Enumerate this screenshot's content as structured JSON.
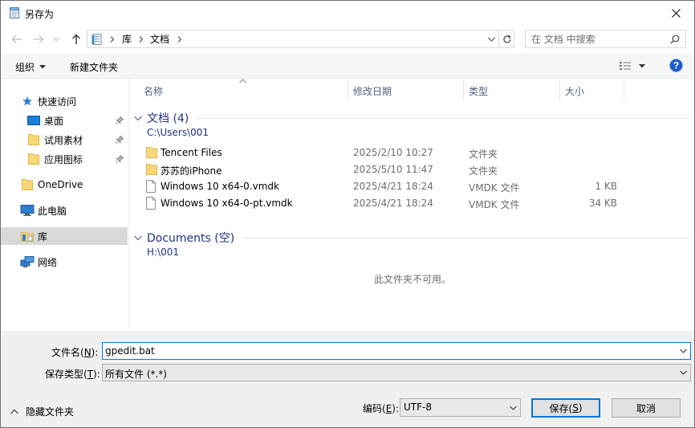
{
  "window": {
    "title": "另存为"
  },
  "address": {
    "crumbs": [
      "库",
      "文档"
    ]
  },
  "search": {
    "placeholder": "在 文档 中搜索"
  },
  "toolbar": {
    "organize_label": "组织",
    "new_folder_label": "新建文件夹"
  },
  "sidebar": {
    "items": [
      {
        "label": "快速访问"
      },
      {
        "label": "桌面"
      },
      {
        "label": "试用素材"
      },
      {
        "label": "应用图标"
      },
      {
        "label": "OneDrive"
      },
      {
        "label": "此电脑"
      },
      {
        "label": "库"
      },
      {
        "label": "网络"
      }
    ]
  },
  "columns": {
    "name": "名称",
    "date": "修改日期",
    "type": "类型",
    "size": "大小"
  },
  "groups": {
    "documents": {
      "title": "文档 (4)",
      "path": "C:\\Users\\001",
      "rows": [
        {
          "name": "Tencent Files",
          "date": "2025/2/10 10:27",
          "type": "文件夹",
          "size": ""
        },
        {
          "name": "苏苏的iPhone",
          "date": "2025/5/10 11:47",
          "type": "文件夹",
          "size": ""
        },
        {
          "name": "Windows 10 x64-0.vmdk",
          "date": "2025/4/21 18:24",
          "type": "VMDK 文件",
          "size": "1 KB"
        },
        {
          "name": "Windows 10 x64-0-pt.vmdk",
          "date": "2025/4/21 18:24",
          "type": "VMDK 文件",
          "size": "34 KB"
        }
      ]
    },
    "documents_h": {
      "title": "Documents (空)",
      "path": "H:\\001",
      "empty_text": "此文件夹不可用。"
    }
  },
  "form": {
    "filename_label_pre": "文件名(",
    "filename_label_key": "N",
    "filename_label_post": "):",
    "filename_value": "gpedit.bat",
    "filetype_label_pre": "保存类型(",
    "filetype_label_key": "T",
    "filetype_label_post": "):",
    "filetype_value": "所有文件  (*.*)",
    "hide_folders_label": "隐藏文件夹",
    "encoding_label_pre": "编码(",
    "encoding_label_key": "E",
    "encoding_label_post": "):",
    "encoding_value": "UTF-8",
    "save_label_pre": "保存(",
    "save_label_key": "S",
    "save_label_post": ")",
    "cancel_label": "取消"
  }
}
